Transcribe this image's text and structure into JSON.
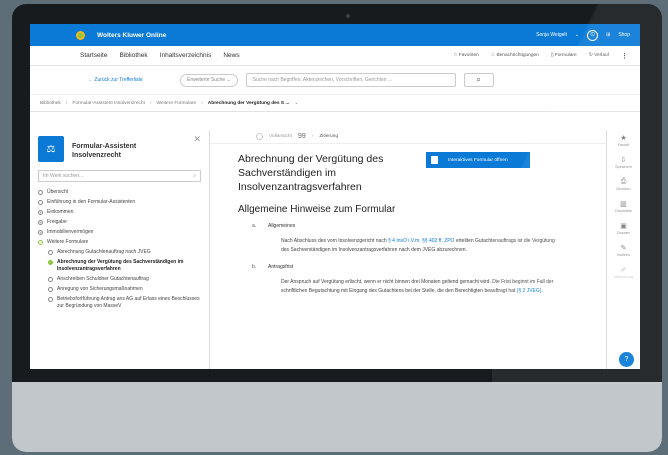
{
  "topbar": {
    "brand": "Wolters Kluwer Online",
    "user": "Sonja Weigelt",
    "user_chevron": "⌄",
    "shop": "Shop"
  },
  "nav": {
    "links": [
      "Startseite",
      "Bibliothek",
      "Inhaltsverzeichnis",
      "News"
    ],
    "favoriten": "Favoriten",
    "benachrichtigungen": "Benachrichtigungen",
    "formulare": "Formulare",
    "verlauf": "Verlauf"
  },
  "search": {
    "back": "Zurück zur Trefferliste",
    "advanced": "Erweiterte Suche",
    "placeholder": "Suche nach Begriffen, Aktenzeichen, Vorschriften, Gerichten ..."
  },
  "breadcrumb": [
    "Bibliothek",
    "Formular-Assistent Insolvenzrecht",
    "Weitere Formulare",
    "Abrechnung der Vergütung des S ..."
  ],
  "sidebar": {
    "title_line1": "Formular-Assistent",
    "title_line2": "Insolvenzrecht",
    "filter_placeholder": "Im Werk suchen...",
    "items": [
      {
        "label": "Übersicht",
        "state": "empty"
      },
      {
        "label": "Einführung in den Formular-Assistenten",
        "state": "empty"
      },
      {
        "label": "Einkommen",
        "state": "plus"
      },
      {
        "label": "Freigabe",
        "state": "plus"
      },
      {
        "label": "Immobilienvermögen",
        "state": "plus"
      },
      {
        "label": "Weitere Formulare",
        "state": "minus"
      }
    ],
    "subitems": [
      {
        "label": "Abrechnung Gutachtenauftrag nach JVEG",
        "active": false
      },
      {
        "label": "Abrechnung der Vergütung des Sachverständigen im Insolvenzantragsverfahren",
        "active": true
      },
      {
        "label": "Anschreiben Schuldner Gutachtenauftrag",
        "active": false
      },
      {
        "label": "Anregung von Sicherungsmaßnahmen",
        "active": false
      },
      {
        "label": "Betriebsfortführung Antrag ans AG auf Erlass eines Beschlusses zur Begründung von MasseV",
        "active": false
      }
    ]
  },
  "doc": {
    "toolbar_left": "Vollansicht",
    "cite_label": "Zitierung",
    "title": "Abrechnung der Vergütung des Sachverständigen im Insolvenzantragsverfahren",
    "form_button": "Interaktives Formular öffnen",
    "heading": "Allgemeine Hinweise zum Formular",
    "sections": [
      {
        "num": "a.",
        "title": "Allgemeines",
        "text_pre": "Nach Abschluss des vom Insolvenzgericht nach ",
        "link1": "§ 4 InsO i.V.m. §§ 402 ff. ZPO",
        "text_post": " erteilten Gutachtenauftrags ist die Vergütung des Sachverständigen im Insolvenzantragsverfahren nach dem JVEG abzurechnen."
      },
      {
        "num": "b.",
        "title": "Antragsfrist",
        "text_pre": "Der Anspruch auf Vergütung erlischt, wenn er nicht binnen drei Monaten geltend gemacht wird. Die Frist beginnt im Fall der schriftlichen Begutachtung mit Eingang des Gutachtens bei der Stelle, die den Berechtigten beauftragt hat ",
        "link1": "(§ 2 JVEG)",
        "text_post": "."
      }
    ]
  },
  "rail": [
    {
      "icon": "★",
      "label": "Favorit"
    },
    {
      "icon": "⇩",
      "label": "Speichern"
    },
    {
      "icon": "⎙",
      "label": "Drucken"
    },
    {
      "icon": "▥",
      "label": "Druckliste"
    },
    {
      "icon": "▣",
      "label": "Dossier"
    },
    {
      "icon": "✎",
      "label": "Notizen"
    },
    {
      "icon": "✐",
      "label": "Markierung"
    }
  ]
}
